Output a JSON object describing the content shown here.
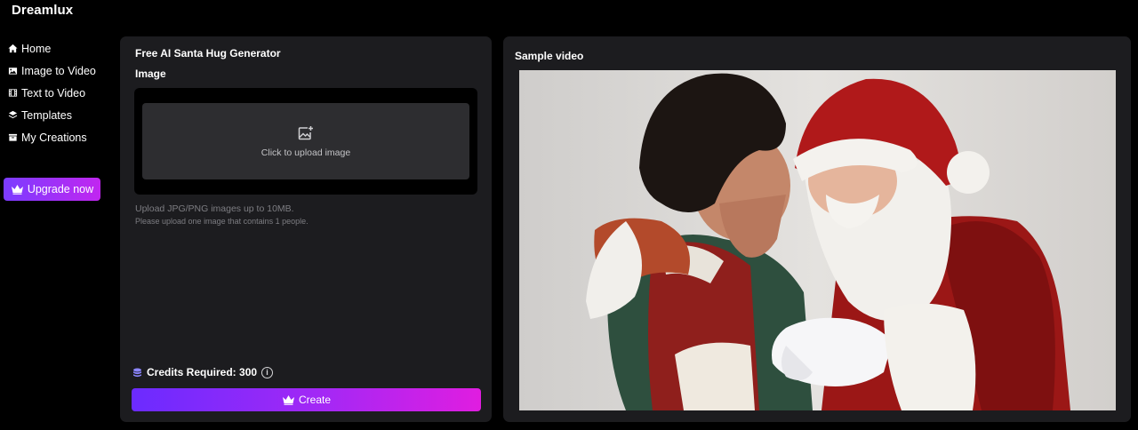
{
  "app": {
    "brand": "Dreamlux"
  },
  "sidebar": {
    "items": [
      {
        "label": "Home",
        "icon": "home-icon"
      },
      {
        "label": "Image to Video",
        "icon": "image-icon"
      },
      {
        "label": "Text to Video",
        "icon": "film-icon"
      },
      {
        "label": "Templates",
        "icon": "layers-icon"
      },
      {
        "label": "My Creations",
        "icon": "folder-icon"
      }
    ],
    "upgrade_label": "Upgrade now"
  },
  "generator": {
    "title": "Free AI Santa Hug Generator",
    "image_label": "Image",
    "upload_text": "Click to upload image",
    "hint_size": "Upload JPG/PNG images up to 10MB.",
    "hint_people": "Please upload one image that contains 1 people.",
    "credits_label": "Credits Required: 300",
    "info_symbol": "i",
    "create_label": "Create"
  },
  "sample": {
    "title": "Sample video"
  },
  "colors": {
    "background": "#000000",
    "panel": "#1c1c1f",
    "upload_box": "#2d2d30",
    "accent_start": "#6b2bff",
    "accent_end": "#e01de0",
    "credits_icon": "#8c86ff"
  }
}
